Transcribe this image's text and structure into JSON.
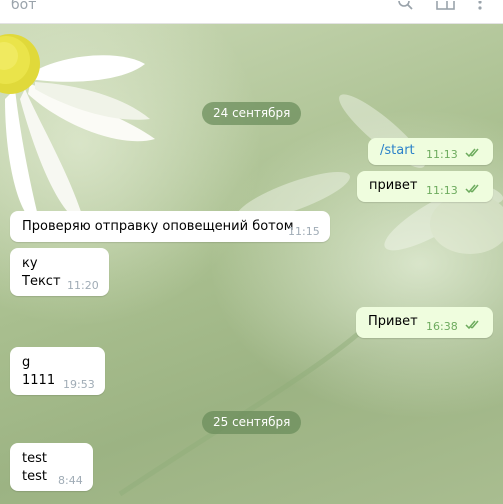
{
  "header": {
    "title": "бот",
    "icons": [
      "search-icon",
      "sidebar-icon",
      "more-icon"
    ]
  },
  "chat": {
    "date_separators": [
      {
        "label": "24 сентября"
      },
      {
        "label": "25 сентября"
      }
    ],
    "messages": [
      {
        "direction": "out",
        "lines": [
          "/start"
        ],
        "time": "11:13",
        "read": true
      },
      {
        "direction": "out",
        "lines": [
          "привет"
        ],
        "time": "11:13",
        "read": true
      },
      {
        "direction": "in",
        "lines": [
          "Проверяю отправку оповещений ботом"
        ],
        "time": "11:15"
      },
      {
        "direction": "in",
        "lines": [
          "ку",
          "Текст"
        ],
        "time": "11:20"
      },
      {
        "direction": "out",
        "lines": [
          "Привет"
        ],
        "time": "16:38",
        "read": true
      },
      {
        "direction": "in",
        "lines": [
          "g",
          "1111"
        ],
        "time": "19:53"
      },
      {
        "direction": "in",
        "lines": [
          "test",
          "test"
        ],
        "time": "8:44"
      }
    ]
  },
  "colors": {
    "incoming_bubble": "#ffffff",
    "outgoing_bubble": "#effdde",
    "outgoing_time": "#6dab5e",
    "incoming_time": "#a0acb6",
    "link": "#2c82c9",
    "date_pill": "#6a8c5a"
  }
}
